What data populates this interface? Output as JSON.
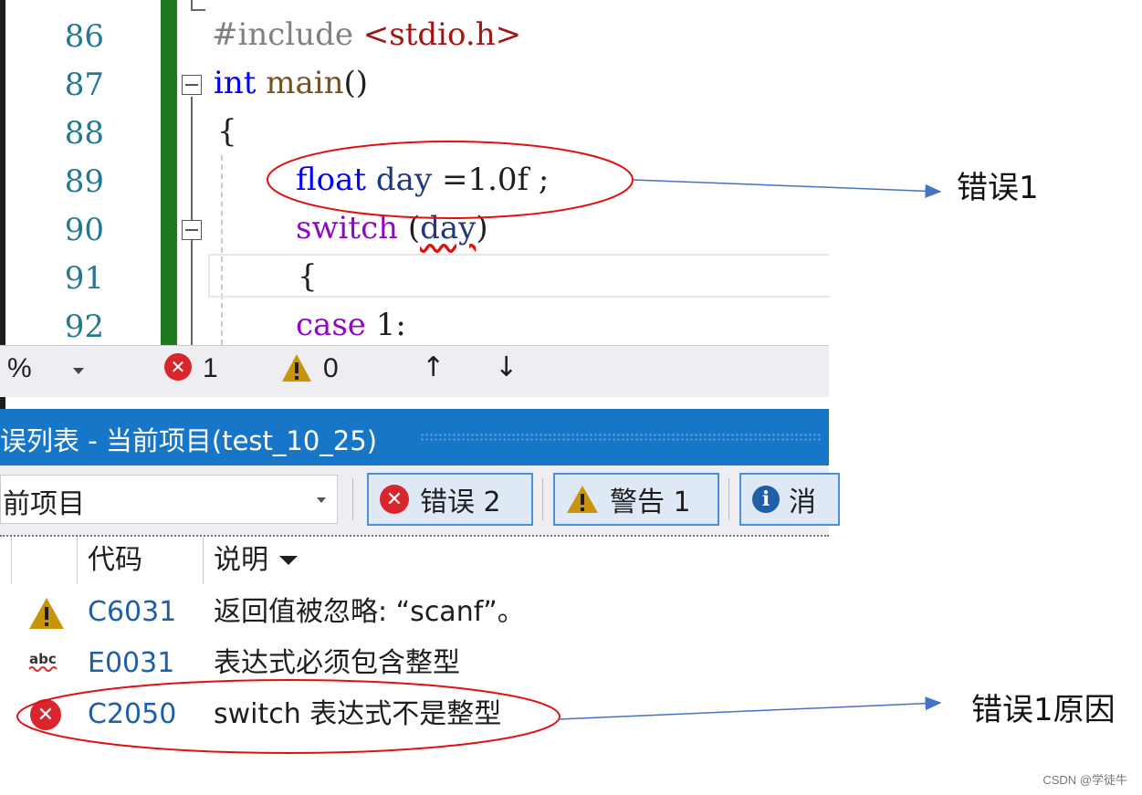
{
  "editor": {
    "line_numbers": [
      "86",
      "87",
      "88",
      "89",
      "90",
      "91",
      "92"
    ],
    "lines": {
      "l86_pre": "#include ",
      "l86_lib": "<stdio.h>",
      "l87_type": "int",
      "l87_fn": "main",
      "l87_parens": "()",
      "l88": "{",
      "l89_type": "float",
      "l89_var": "day",
      "l89_op": " =",
      "l89_num": "1.0f",
      "l89_end": " ;",
      "l90_kw": "switch",
      "l90_open": " (",
      "l90_var": "day",
      "l90_close": ")",
      "l91": "{",
      "l92_kw": "case",
      "l92_num": " 1",
      "l92_colon": ":"
    }
  },
  "toolbar": {
    "zoom_value": "%",
    "error_count": "1",
    "warning_count": "0",
    "up_arrow": "↑",
    "down_arrow": "↓"
  },
  "panel": {
    "title": "误列表 - 当前项目(test_10_25)",
    "scope_selected": "前项目",
    "errors_label": "错误 2",
    "warnings_label": "警告 1",
    "messages_label": "消"
  },
  "table": {
    "col_code": "代码",
    "col_desc": "说明",
    "rows": [
      {
        "icon": "warning-icon",
        "code": "C6031",
        "desc": "返回值被忽略: “scanf”。"
      },
      {
        "icon": "abc-spell-icon",
        "code": "E0031",
        "desc": "表达式必须包含整型"
      },
      {
        "icon": "error-icon",
        "code": "C2050",
        "desc": "switch 表达式不是整型"
      }
    ]
  },
  "annotations": {
    "label1": "错误1",
    "label2": "错误1原因",
    "ellipse_color": "#e01010",
    "arrow_color": "#4472c4"
  },
  "watermark": "CSDN @学徒牛",
  "colors": {
    "panel_header": "#1876c9",
    "change_bar": "#1f7a1f",
    "error_red": "#d9262c",
    "warning_amber": "#c8940c"
  }
}
